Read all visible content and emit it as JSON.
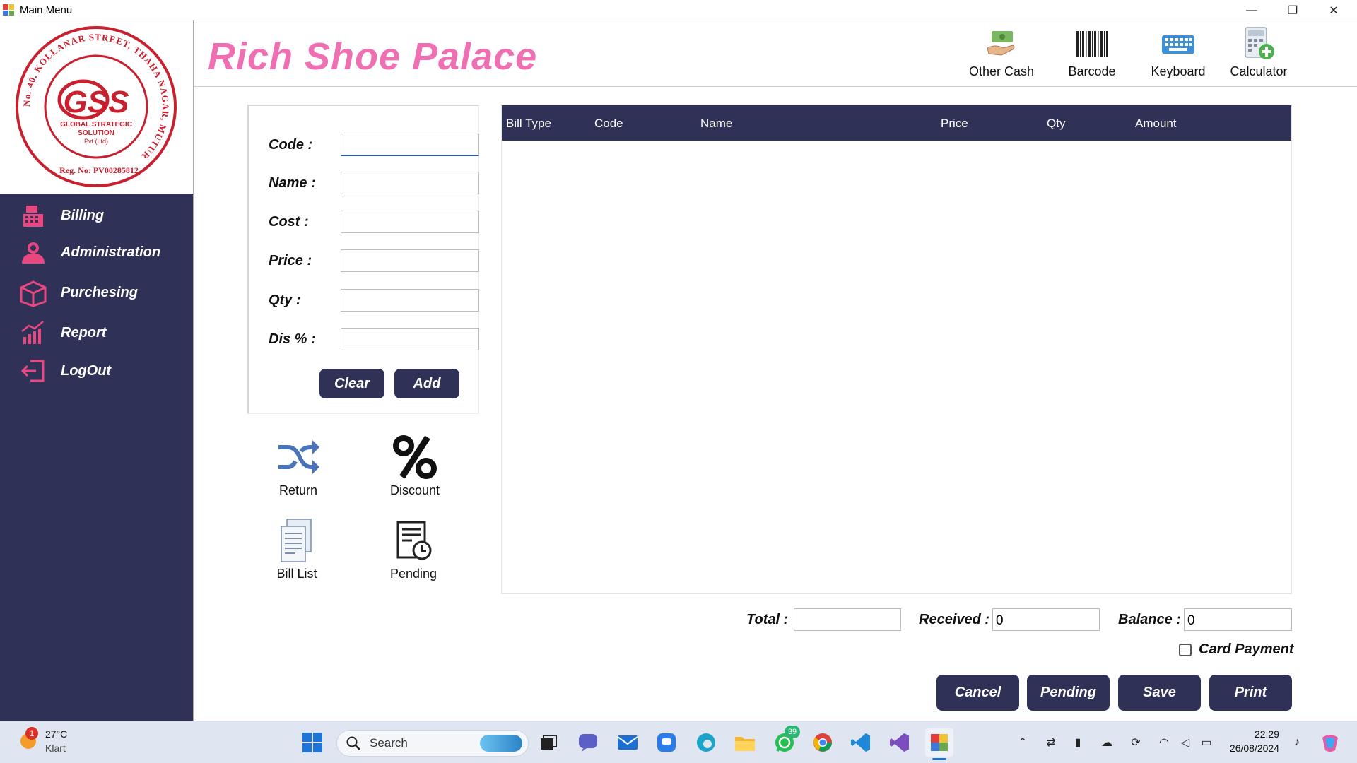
{
  "window": {
    "title": "Main Menu",
    "minimize_glyph": "—",
    "restore_glyph": "❐",
    "close_glyph": "✕"
  },
  "logo": {
    "ring_text": "No. 40, KOLLANAR STREET, THAHA NAGAR, MUTUR",
    "center_text": "GSS",
    "sub_text_1": "GLOBAL STRATEGIC",
    "sub_text_2": "SOLUTION",
    "sub_text_3": "Pvt (Ltd)",
    "reg_text": "Reg. No: PV00285812"
  },
  "sidebar": {
    "items": [
      {
        "label": "Billing",
        "icon": "register-icon"
      },
      {
        "label": "Administration",
        "icon": "users-icon"
      },
      {
        "label": "Purchesing",
        "icon": "box-icon"
      },
      {
        "label": "Report",
        "icon": "chart-icon"
      },
      {
        "label": "LogOut",
        "icon": "logout-icon"
      }
    ]
  },
  "header": {
    "brand": "Rich Shoe Palace",
    "tools": [
      {
        "label": "Other Cash",
        "icon": "cash-hand-icon"
      },
      {
        "label": "Barcode",
        "icon": "barcode-icon"
      },
      {
        "label": "Keyboard",
        "icon": "keyboard-icon"
      },
      {
        "label": "Calculator",
        "icon": "calculator-icon"
      }
    ]
  },
  "form": {
    "fields": [
      {
        "label": "Code :",
        "value": ""
      },
      {
        "label": "Name :",
        "value": ""
      },
      {
        "label": "Cost :",
        "value": ""
      },
      {
        "label": "Price :",
        "value": ""
      },
      {
        "label": "Qty :",
        "value": ""
      },
      {
        "label": "Dis % :",
        "value": ""
      }
    ],
    "clear_label": "Clear",
    "add_label": "Add"
  },
  "quick_actions": [
    {
      "label": "Return",
      "icon": "shuffle-icon"
    },
    {
      "label": "Discount",
      "icon": "percent-icon"
    },
    {
      "label": "Bill List",
      "icon": "bill-list-icon"
    },
    {
      "label": "Pending",
      "icon": "pending-clock-icon"
    }
  ],
  "grid": {
    "columns": [
      "Bill Type",
      "Code",
      "Name",
      "Price",
      "Qty",
      "Amount"
    ],
    "rows": []
  },
  "totals": {
    "total_label": "Total :",
    "total_value": "",
    "received_label": "Received :",
    "received_value": "0",
    "balance_label": "Balance :",
    "balance_value": "0",
    "card_payment_label": "Card Payment",
    "card_payment_checked": false
  },
  "actions": {
    "cancel": "Cancel",
    "pending": "Pending",
    "save": "Save",
    "print": "Print"
  },
  "taskbar": {
    "weather_badge": "1",
    "weather_temp": "27°C",
    "weather_desc": "Klart",
    "search_placeholder": "Search",
    "whatsapp_badge": "39",
    "time": "22:29",
    "date": "26/08/2024"
  },
  "colors": {
    "sidebar_bg": "#2f3156",
    "brand_pink": "#ee6fb2",
    "nav_icon_pink": "#e8477f",
    "logo_red": "#c8202f"
  }
}
